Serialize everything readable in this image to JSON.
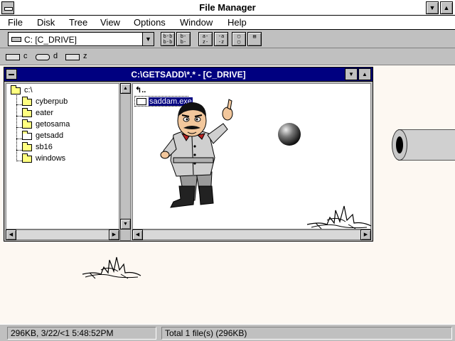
{
  "app": {
    "title": "File Manager"
  },
  "menu": [
    "File",
    "Disk",
    "Tree",
    "View",
    "Options",
    "Window",
    "Help"
  ],
  "toolbar": {
    "drive_combo": "C: [C_DRIVE]",
    "buttons": [
      "b-b-b-b",
      "b- b- b-",
      "a-z z-z",
      "-a- z-z",
      "copy",
      "move"
    ]
  },
  "drives": [
    {
      "letter": "c"
    },
    {
      "letter": "d"
    },
    {
      "letter": "z"
    }
  ],
  "child_window": {
    "title": "C:\\GETSADD\\*.* - [C_DRIVE]",
    "tree": [
      {
        "label": "c:\\"
      },
      {
        "label": "cyberpub"
      },
      {
        "label": "eater"
      },
      {
        "label": "getosama"
      },
      {
        "label": "getsadd"
      },
      {
        "label": "sb16"
      },
      {
        "label": "windows"
      }
    ],
    "files": [
      {
        "label": ".."
      },
      {
        "label": "saddam.exe"
      }
    ]
  },
  "status": {
    "selection": "296KB, 3/22/<1 5:48:52PM",
    "total": "Total 1 file(s) (296KB)"
  },
  "colors": {
    "active_title": "#000080",
    "folder": "#ffff80",
    "chrome": "#c0c0c0",
    "desktop": "#fdf8f2"
  }
}
